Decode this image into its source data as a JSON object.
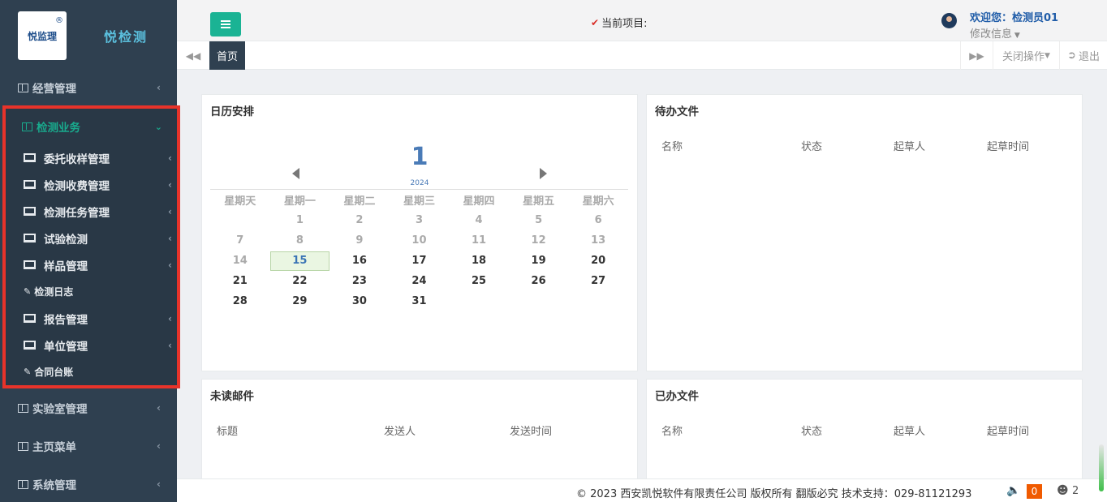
{
  "sidebar": {
    "logo_text": "悦监理",
    "logo_mark": "®",
    "brand": "悦检测",
    "top_items": [
      {
        "label": "经营管理"
      }
    ],
    "active_group": {
      "label": "检测业务",
      "items": [
        {
          "label": "委托收样管理",
          "icon": "monitor-icon",
          "has_children": true
        },
        {
          "label": "检测收费管理",
          "icon": "monitor-icon",
          "has_children": true
        },
        {
          "label": "检测任务管理",
          "icon": "monitor-icon",
          "has_children": true
        },
        {
          "label": "试验检测",
          "icon": "monitor-icon",
          "has_children": true
        },
        {
          "label": "样品管理",
          "icon": "monitor-icon",
          "has_children": true
        },
        {
          "label": "检测日志",
          "icon": "edit-icon",
          "has_children": false
        },
        {
          "label": "报告管理",
          "icon": "monitor-icon",
          "has_children": true
        },
        {
          "label": "单位管理",
          "icon": "monitor-icon",
          "has_children": true
        },
        {
          "label": "合同台账",
          "icon": "edit-icon",
          "has_children": false
        }
      ]
    },
    "bottom_items": [
      {
        "label": "实验室管理"
      },
      {
        "label": "主页菜单"
      },
      {
        "label": "系统管理"
      }
    ]
  },
  "header": {
    "current_project_label": "当前项目:",
    "welcome": "欢迎您：检测员01",
    "modify_info": "修改信息"
  },
  "tabs": {
    "home": "首页",
    "close_ops": "关闭操作",
    "logout": "退出"
  },
  "calendar": {
    "title": "日历安排",
    "selected_day": "1",
    "year": "2024",
    "weekdays": [
      "星期天",
      "星期一",
      "星期二",
      "星期三",
      "星期四",
      "星期五",
      "星期六"
    ],
    "days": [
      {
        "n": "",
        "s": "blank"
      },
      {
        "n": "1",
        "s": "past"
      },
      {
        "n": "2",
        "s": "past"
      },
      {
        "n": "3",
        "s": "past"
      },
      {
        "n": "4",
        "s": "past"
      },
      {
        "n": "5",
        "s": "past"
      },
      {
        "n": "6",
        "s": "past"
      },
      {
        "n": "7",
        "s": "past"
      },
      {
        "n": "8",
        "s": "past"
      },
      {
        "n": "9",
        "s": "past"
      },
      {
        "n": "10",
        "s": "past"
      },
      {
        "n": "11",
        "s": "past"
      },
      {
        "n": "12",
        "s": "past"
      },
      {
        "n": "13",
        "s": "past"
      },
      {
        "n": "14",
        "s": "past"
      },
      {
        "n": "15",
        "s": "today"
      },
      {
        "n": "16",
        "s": "future"
      },
      {
        "n": "17",
        "s": "future"
      },
      {
        "n": "18",
        "s": "future"
      },
      {
        "n": "19",
        "s": "future"
      },
      {
        "n": "20",
        "s": "future"
      },
      {
        "n": "21",
        "s": "future"
      },
      {
        "n": "22",
        "s": "future"
      },
      {
        "n": "23",
        "s": "future"
      },
      {
        "n": "24",
        "s": "future"
      },
      {
        "n": "25",
        "s": "future"
      },
      {
        "n": "26",
        "s": "future"
      },
      {
        "n": "27",
        "s": "future"
      },
      {
        "n": "28",
        "s": "future"
      },
      {
        "n": "29",
        "s": "future"
      },
      {
        "n": "30",
        "s": "future"
      },
      {
        "n": "31",
        "s": "future"
      }
    ]
  },
  "todo": {
    "title": "待办文件",
    "columns": [
      "名称",
      "状态",
      "起草人",
      "起草时间"
    ]
  },
  "unread_mail": {
    "title": "未读邮件",
    "columns": [
      "标题",
      "发送人",
      "发送时间"
    ]
  },
  "done": {
    "title": "已办文件",
    "columns": [
      "名称",
      "状态",
      "起草人",
      "起草时间"
    ]
  },
  "footer": {
    "copyright": "© 2023 西安凯悦软件有限责任公司 版权所有 翻版必究 技术支持：029-81121293",
    "notification_count": "0",
    "online_users": "2"
  },
  "colors": {
    "sidebar_bg": "#2f4050",
    "accent_green": "#1ab394",
    "highlight_red": "#e8332a",
    "link_blue": "#1f5ca8"
  }
}
